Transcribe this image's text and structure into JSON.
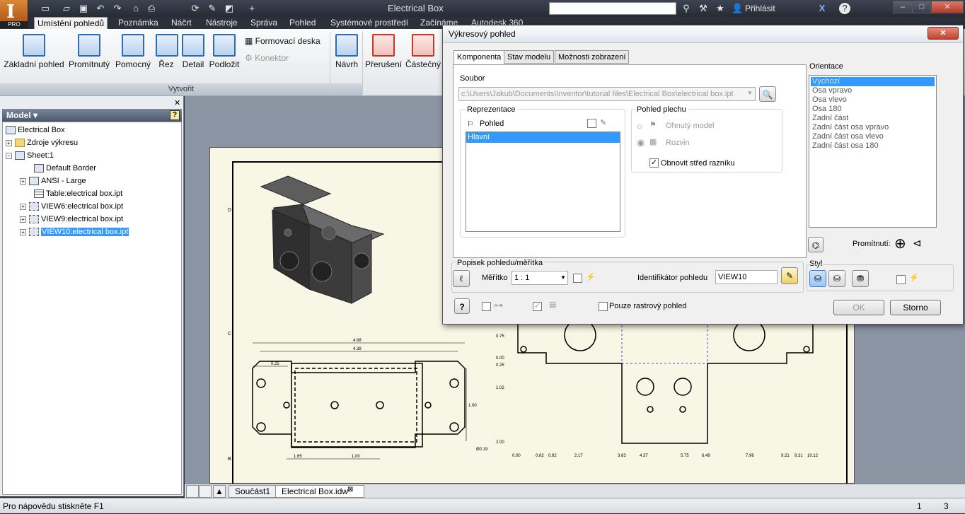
{
  "app": {
    "logo_letter": "I",
    "logo_sub": "PRO",
    "window_title": "Electrical Box",
    "sign_in": "Přihlásit",
    "help": "?"
  },
  "ribbon": {
    "tabs": [
      "Umístění pohledů",
      "Poznámka",
      "Náčrt",
      "Nástroje",
      "Správa",
      "Pohled",
      "Systémové prostředí",
      "Začínáme",
      "Autodesk 360"
    ],
    "buttons": [
      "Základní pohled",
      "Promítnutý",
      "Pomocný",
      "Řez",
      "Detail",
      "Podložit",
      "Návrh",
      "Přerušení",
      "Částečný"
    ],
    "small_buttons": [
      "Formovací deska",
      "Konektor"
    ],
    "panel_label": "Vytvořit"
  },
  "browser": {
    "title": "Model ▾",
    "tree": [
      {
        "label": "Electrical Box",
        "level": 0,
        "icon": "drawing-icon"
      },
      {
        "label": "Zdroje výkresu",
        "level": 1,
        "icon": "folder-icon"
      },
      {
        "label": "Sheet:1",
        "level": 1,
        "icon": "sheet-icon"
      },
      {
        "label": "Default Border",
        "level": 2,
        "icon": "border-icon"
      },
      {
        "label": "ANSI - Large",
        "level": 2,
        "icon": "titleblock-icon"
      },
      {
        "label": "Table:electrical box.ipt",
        "level": 2,
        "icon": "table-icon"
      },
      {
        "label": "VIEW6:electrical box.ipt",
        "level": 2,
        "icon": "view-icon"
      },
      {
        "label": "VIEW9:electrical box.ipt",
        "level": 2,
        "icon": "view-icon"
      },
      {
        "label": "VIEW10:electrical box.ipt",
        "level": 2,
        "icon": "view-icon"
      }
    ]
  },
  "doc_tabs": [
    "Součást1",
    "Electrical Box.idw"
  ],
  "status": {
    "help_text": "Pro nápovědu stiskněte F1",
    "page": "1",
    "count": "3"
  },
  "drawing": {
    "dims_top": [
      "4.88",
      "4.38",
      "0.25",
      "1.00",
      "1.65",
      "1.00",
      "Ø0.19"
    ],
    "dims_flat_y": [
      "0.75",
      "0.00",
      "0.25",
      "1.02",
      "2.00"
    ],
    "dims_flat_x": [
      "0.00",
      "0.82",
      "0.92",
      "2.17",
      "3.63",
      "4.37",
      "5.75",
      "6.49",
      "7.96",
      "9.21",
      "9.31",
      "10.12"
    ],
    "zone_letters": [
      "D",
      "C",
      "B"
    ]
  },
  "dialog": {
    "title": "Výkresový pohled",
    "close": "✕",
    "tabs": [
      "Komponenta",
      "Stav modelu",
      "Možnosti zobrazení"
    ],
    "file_label": "Soubor",
    "file_path": "c:\\Users\\Jakub\\Documents\\Inventor\\tutorial files\\Electrical Box\\electrical box.ipt",
    "repr_label": "Reprezentace",
    "repr_view": "Pohled",
    "repr_item": "Hlavní",
    "sheet_label": "Pohled plechu",
    "sheet_opt1": "Ohnutý model",
    "sheet_opt2": "Rozvin",
    "sheet_chk": "Obnovit střed razníku",
    "orient_label": "Orientace",
    "orientations": [
      "Výchozí",
      "Osa vpravo",
      "Osa vlevo",
      "Osa 180",
      "Zadní část",
      "Zadní část osa vpravo",
      "Zadní část osa vlevo",
      "Zadní část osa 180"
    ],
    "projection_label": "Promítnutí:",
    "scale_group": "Popisek pohledu/měřítka",
    "scale_label": "Měřítko",
    "scale_value": "1 : 1",
    "view_id_label": "Identifikátor pohledu",
    "view_id_value": "VIEW10",
    "style_label": "Styl",
    "raster_label": "Pouze rastrový pohled",
    "ok": "OK",
    "cancel": "Storno",
    "help_btn": "?"
  }
}
